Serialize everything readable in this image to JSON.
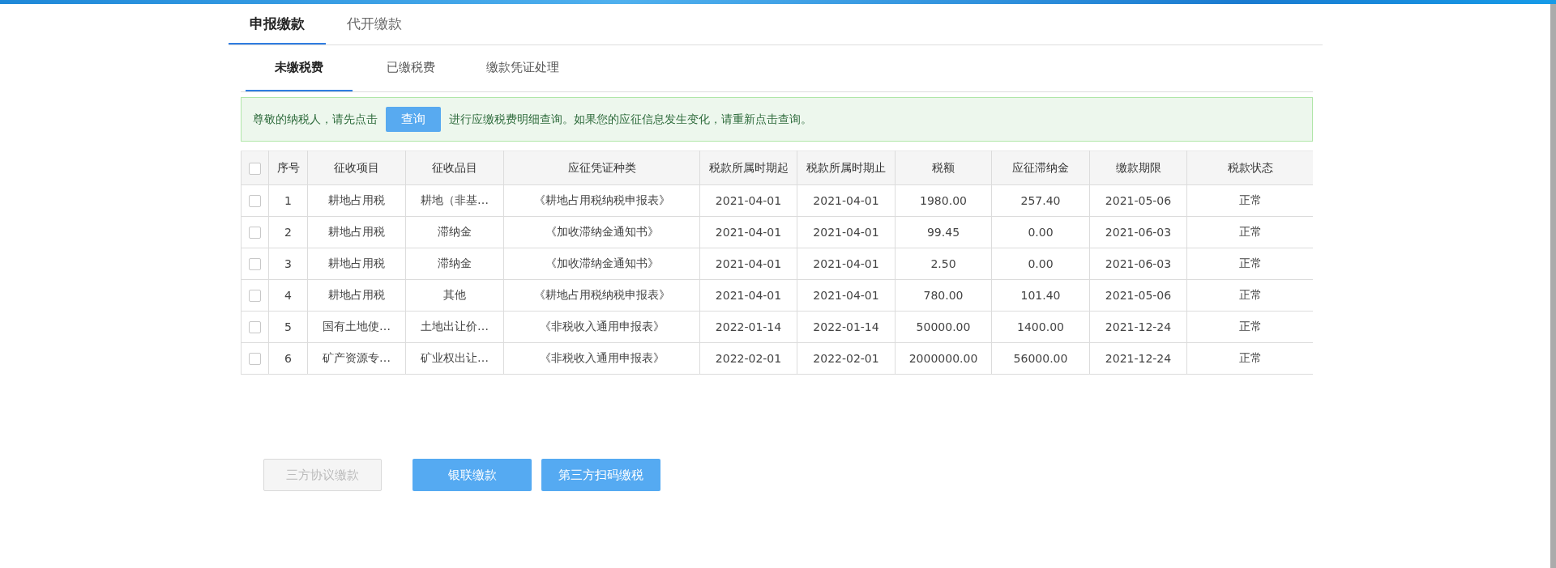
{
  "main_tabs": [
    {
      "label": "申报缴款",
      "selected": true
    },
    {
      "label": "代开缴款",
      "selected": false
    }
  ],
  "sub_tabs": [
    {
      "label": "未缴税费",
      "selected": true
    },
    {
      "label": "已缴税费",
      "selected": false
    },
    {
      "label": "缴款凭证处理",
      "selected": false
    }
  ],
  "notice": {
    "before": "尊敬的纳税人，请先点击",
    "button": "查询",
    "after": "进行应缴税费明细查询。如果您的应征信息发生变化，请重新点击查询。"
  },
  "table": {
    "select_all_checked": false,
    "columns": [
      "序号",
      "征收项目",
      "征收品目",
      "应征凭证种类",
      "税款所属时期起",
      "税款所属时期止",
      "税额",
      "应征滞纳金",
      "缴款期限",
      "税款状态"
    ],
    "rows": [
      {
        "checked": false,
        "cells": [
          "1",
          "耕地占用税",
          "耕地（非基…",
          "《耕地占用税纳税申报表》",
          "2021-04-01",
          "2021-04-01",
          "1980.00",
          "257.40",
          "2021-05-06",
          "正常"
        ]
      },
      {
        "checked": false,
        "cells": [
          "2",
          "耕地占用税",
          "滞纳金",
          "《加收滞纳金通知书》",
          "2021-04-01",
          "2021-04-01",
          "99.45",
          "0.00",
          "2021-06-03",
          "正常"
        ]
      },
      {
        "checked": false,
        "cells": [
          "3",
          "耕地占用税",
          "滞纳金",
          "《加收滞纳金通知书》",
          "2021-04-01",
          "2021-04-01",
          "2.50",
          "0.00",
          "2021-06-03",
          "正常"
        ]
      },
      {
        "checked": false,
        "cells": [
          "4",
          "耕地占用税",
          "其他",
          "《耕地占用税纳税申报表》",
          "2021-04-01",
          "2021-04-01",
          "780.00",
          "101.40",
          "2021-05-06",
          "正常"
        ]
      },
      {
        "checked": false,
        "cells": [
          "5",
          "国有土地使…",
          "土地出让价…",
          "《非税收入通用申报表》",
          "2022-01-14",
          "2022-01-14",
          "50000.00",
          "1400.00",
          "2021-12-24",
          "正常"
        ]
      },
      {
        "checked": false,
        "cells": [
          "6",
          "矿产资源专…",
          "矿业权出让…",
          "《非税收入通用申报表》",
          "2022-02-01",
          "2022-02-01",
          "2000000.00",
          "56000.00",
          "2021-12-24",
          "正常"
        ]
      }
    ]
  },
  "buttons": [
    {
      "label": "三方协议缴款",
      "disabled": true
    },
    {
      "label": "银联缴款",
      "disabled": false
    },
    {
      "label": "第三方扫码缴税",
      "disabled": false
    }
  ]
}
